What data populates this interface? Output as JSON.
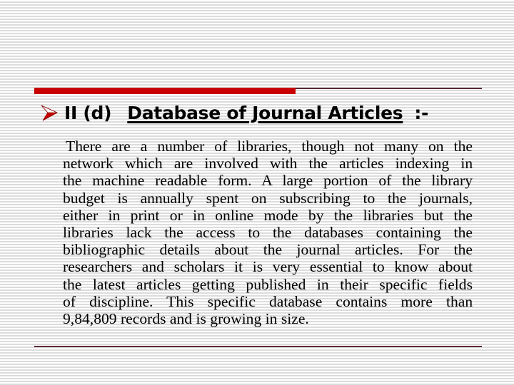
{
  "slide": {
    "heading": {
      "bullet_icon": "arrow-bullet-icon",
      "prefix": "II (d)",
      "title": "Database of Journal Articles",
      "suffix": ":-"
    },
    "body_lines": [
      "There are a number of libraries, though not many on the",
      "network which are involved with the articles indexing in",
      "the machine readable form. A large portion of the library",
      "budget is annually spent on subscribing to the journals,",
      "either in print or in online mode by the libraries but the",
      "libraries lack the access to the databases containing the",
      "bibliographic details about the journal articles. For the",
      "researchers and scholars it is very essential to know about",
      "the latest articles getting published in their specific fields",
      "of discipline. This specific database contains more than",
      "9,84,809 records and is growing in size."
    ],
    "colors": {
      "accent_bar": "#c80000",
      "rule": "#5e2a36",
      "stripe": "#dcdcdc"
    }
  }
}
